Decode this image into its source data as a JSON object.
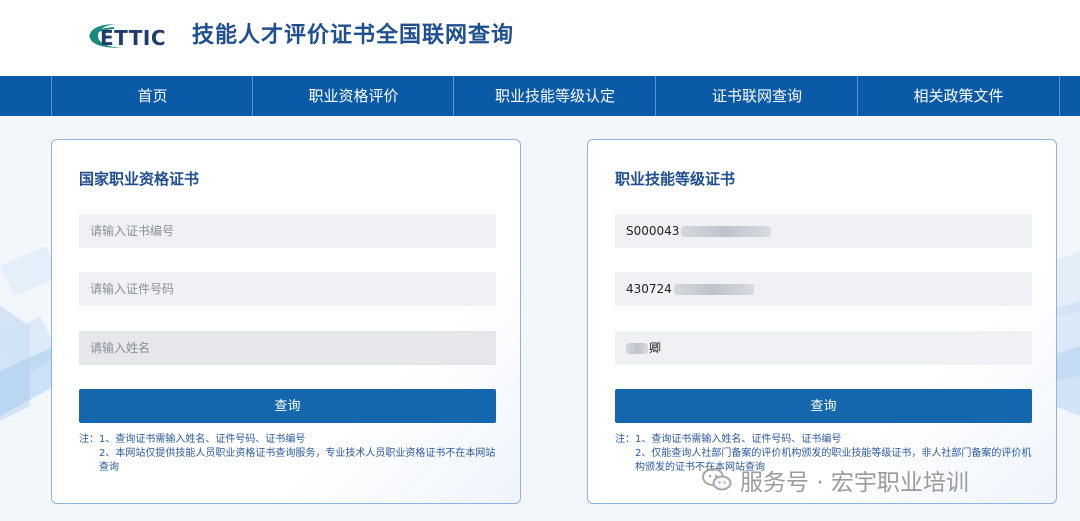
{
  "header": {
    "logo_text": "ETTIC",
    "title": "技能人才评价证书全国联网查询"
  },
  "nav": {
    "items": [
      {
        "label": "首页"
      },
      {
        "label": "职业资格评价"
      },
      {
        "label": "职业技能等级认定"
      },
      {
        "label": "证书联网查询"
      },
      {
        "label": "相关政策文件"
      }
    ]
  },
  "left_card": {
    "title": "国家职业资格证书",
    "cert_no_placeholder": "请输入证书编号",
    "id_no_placeholder": "请输入证件号码",
    "name_placeholder": "请输入姓名",
    "button": "查询",
    "note1": "注：1、查询证书需输入姓名、证件号码、证书编号",
    "note2": "2、本网站仅提供技能人员职业资格证书查询服务，专业技术人员职业资格证书不在本网站查询"
  },
  "right_card": {
    "title": "职业技能等级证书",
    "cert_no_value": "S000043",
    "id_no_value": "430724",
    "name_value": "卿",
    "button": "查询",
    "note1": "注：1、查询证书需输入姓名、证件号码、证书编号",
    "note2": "2、仅能查询人社部门备案的评价机构颁发的职业技能等级证书，非人社部门备案的评价机构颁发的证书不在本网站查询"
  },
  "watermark": {
    "text": "服务号 · 宏宇职业培训"
  },
  "colors": {
    "nav_bg": "#0a5aa8",
    "title_blue": "#1f4f8f",
    "button_blue": "#1466ad",
    "logo_teal": "#1a8a7a"
  }
}
